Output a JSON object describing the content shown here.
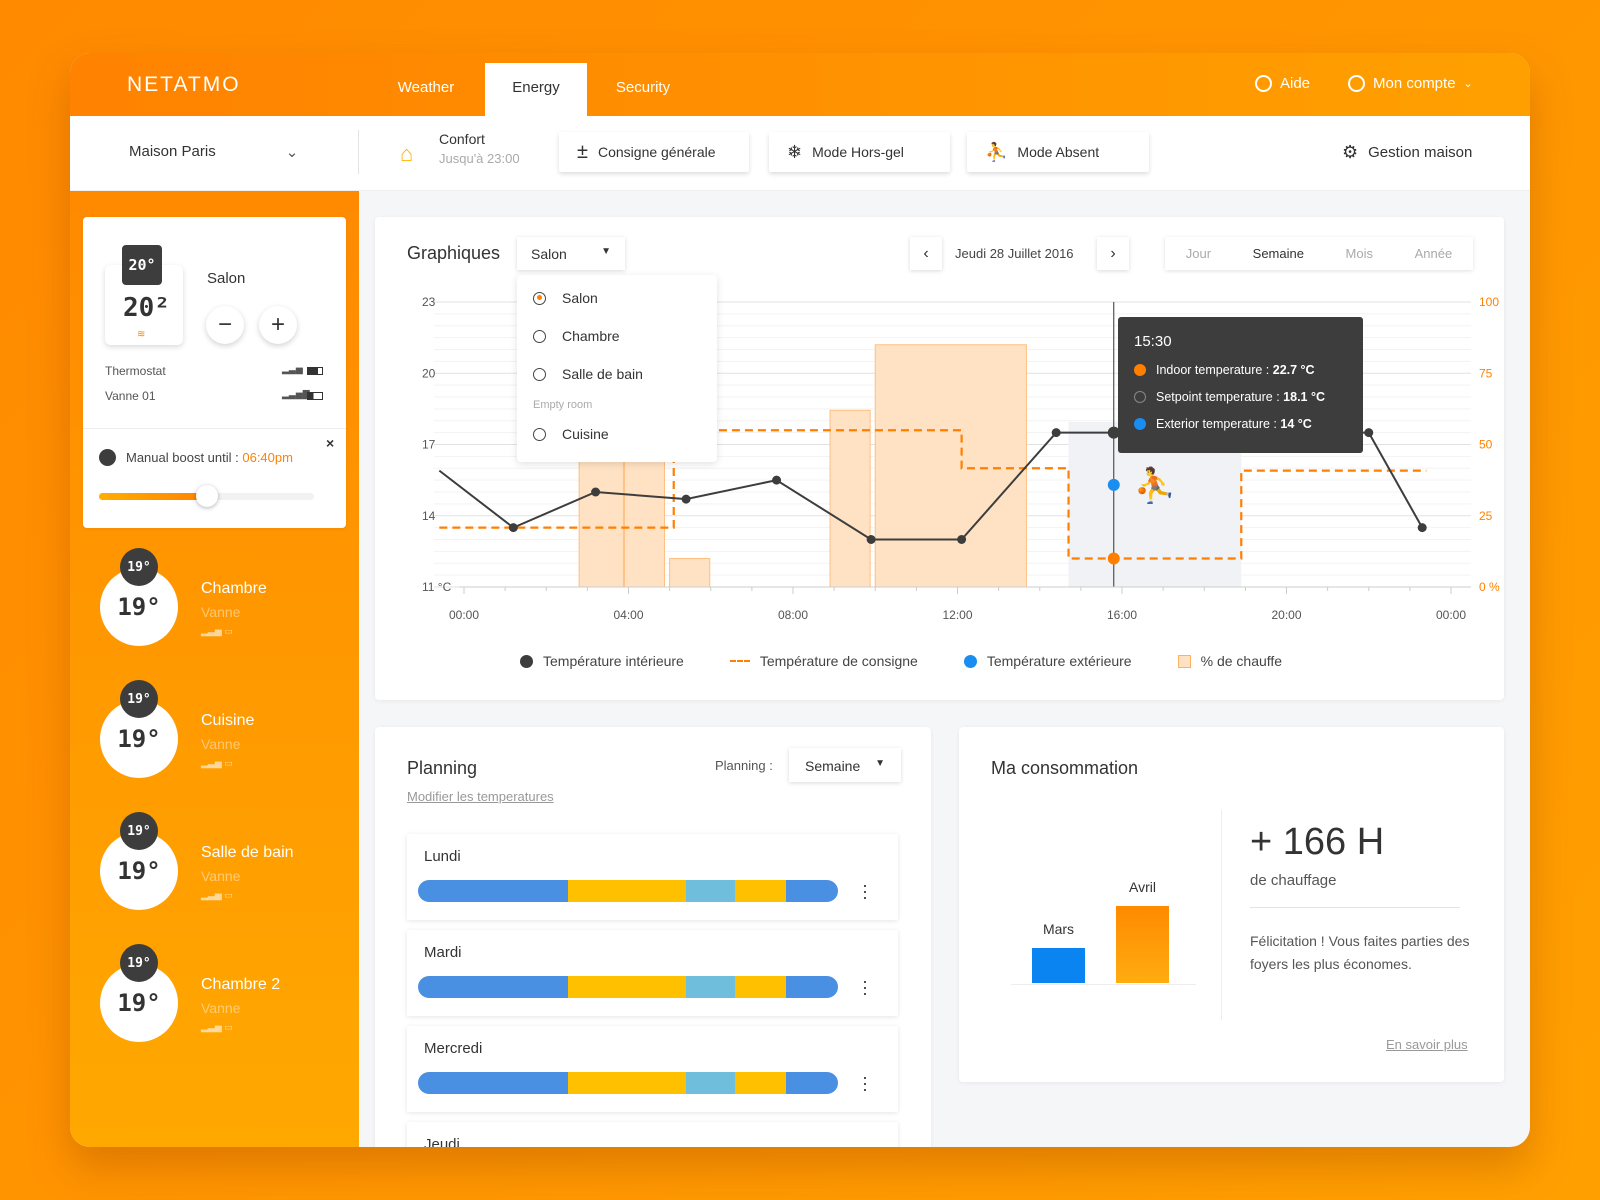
{
  "app": {
    "logo": "NETATMO",
    "tabs": [
      {
        "label": "Weather"
      },
      {
        "label": "Energy",
        "active": true
      },
      {
        "label": "Security"
      }
    ],
    "help": "Aide",
    "account": "Mon compte"
  },
  "toolbar": {
    "home": "Maison Paris",
    "mode_title": "Confort",
    "mode_until": "Jusqu'à 23:00",
    "consigne": "Consigne générale",
    "horsgel": "Mode Hors-gel",
    "absent": "Mode Absent",
    "gestion": "Gestion maison"
  },
  "current_room": {
    "name": "Salon",
    "setpoint": "20°",
    "temperature": "20²",
    "devices": [
      {
        "name": "Thermostat"
      },
      {
        "name": "Vanne 01"
      }
    ],
    "boost_label": "Manual boost until :",
    "boost_time": "06:40pm",
    "boost_progress": 0.5
  },
  "rooms": [
    {
      "name": "Chambre",
      "device": "Vanne",
      "setpoint": "19°",
      "temperature": "19°"
    },
    {
      "name": "Cuisine",
      "device": "Vanne",
      "setpoint": "19°",
      "temperature": "19°"
    },
    {
      "name": "Salle de bain",
      "device": "Vanne",
      "setpoint": "19°",
      "temperature": "19°"
    },
    {
      "name": "Chambre 2",
      "device": "Vanne",
      "setpoint": "19°",
      "temperature": "19°"
    }
  ],
  "graph": {
    "title": "Graphiques",
    "room_select": "Salon",
    "date": "Jeudi 28 Juillet 2016",
    "periods": [
      "Jour",
      "Semaine",
      "Mois",
      "Année"
    ],
    "active_period": "Semaine",
    "dropdown": {
      "items": [
        "Salon",
        "Chambre",
        "Salle de bain"
      ],
      "selected": "Salon",
      "empty_label": "Empty room",
      "empty_items": [
        "Cuisine"
      ]
    },
    "tooltip": {
      "time": "15:30",
      "rows": [
        {
          "label": "Indoor temperature :",
          "value": "22.7 °C",
          "color": "#ff7f00"
        },
        {
          "label": "Setpoint temperature :",
          "value": "18.1 °C",
          "color": "none"
        },
        {
          "label": "Exterior temperature :",
          "value": "14 °C",
          "color": "#1a8ef0"
        }
      ]
    }
  },
  "chart_data": {
    "type": "line",
    "xlabel": "",
    "ylabel": "°C",
    "ylim": [
      11,
      23
    ],
    "y2lim": [
      0,
      100
    ],
    "y_ticks": [
      "23",
      "20",
      "17",
      "14",
      "11 °C"
    ],
    "y_tick_values": [
      23,
      20,
      17,
      14,
      11
    ],
    "y2_ticks": [
      "100",
      "75",
      "50",
      "25",
      "0 %"
    ],
    "y2_tick_values": [
      100,
      75,
      50,
      25,
      0
    ],
    "x_ticks": [
      "00:00",
      "04:00",
      "08:00",
      "12:00",
      "16:00",
      "20:00",
      "00:00"
    ],
    "x_tick_hours": [
      0,
      4,
      8,
      12,
      16,
      20,
      24
    ],
    "series": [
      {
        "name": "Température intérieure",
        "color": "#3d3d3d",
        "points": [
          [
            -0.6,
            15.9
          ],
          [
            1.2,
            13.5
          ],
          [
            3.2,
            15.0
          ],
          [
            5.4,
            14.7
          ],
          [
            7.6,
            15.5
          ],
          [
            9.9,
            13.0
          ],
          [
            12.1,
            13.0
          ],
          [
            14.4,
            17.5
          ],
          [
            15.8,
            17.5
          ],
          [
            22.0,
            17.5
          ],
          [
            23.3,
            13.5
          ]
        ]
      },
      {
        "name": "Température de consigne",
        "color": "#ff7f00",
        "steps": [
          [
            -0.6,
            5.1,
            13.5
          ],
          [
            5.1,
            12.1,
            17.6
          ],
          [
            12.1,
            14.7,
            16.0
          ],
          [
            14.7,
            18.9,
            12.2
          ],
          [
            18.9,
            23.4,
            15.9
          ]
        ]
      },
      {
        "name": "Température extérieure",
        "color": "#1a8ef0",
        "points": [
          [
            15.8,
            15.3
          ]
        ]
      },
      {
        "name": "% de chauffe",
        "color": "#ffe2c4",
        "bars": [
          [
            2.8,
            3.9,
            60
          ],
          [
            3.9,
            4.9,
            60
          ],
          [
            5.0,
            6.0,
            10
          ],
          [
            8.9,
            9.9,
            62
          ],
          [
            10.0,
            13.7,
            85
          ]
        ]
      }
    ],
    "absent_period": [
      14.7,
      18.9
    ],
    "cursor_hour": 15.8,
    "legend": [
      "Température intérieure",
      "Température de consigne",
      "Température extérieure",
      "% de chauffe"
    ]
  },
  "planning": {
    "title": "Planning",
    "link": "Modifier les temperatures",
    "select_label": "Planning :",
    "select_value": "Semaine",
    "segment_colors": {
      "comfort": "#ffc000",
      "night": "#4a90e2",
      "eco": "#6fbfdc"
    },
    "days": [
      {
        "label": "Lundi",
        "segments": [
          [
            "night",
            0.356
          ],
          [
            "comfort",
            0.283
          ],
          [
            "eco",
            0.115
          ],
          [
            "comfort",
            0.122
          ],
          [
            "night",
            0.124
          ]
        ]
      },
      {
        "label": "Mardi",
        "segments": [
          [
            "night",
            0.356
          ],
          [
            "comfort",
            0.283
          ],
          [
            "eco",
            0.115
          ],
          [
            "comfort",
            0.122
          ],
          [
            "night",
            0.124
          ]
        ]
      },
      {
        "label": "Mercredi",
        "segments": [
          [
            "night",
            0.356
          ],
          [
            "comfort",
            0.283
          ],
          [
            "eco",
            0.115
          ],
          [
            "comfort",
            0.122
          ],
          [
            "night",
            0.124
          ]
        ]
      },
      {
        "label": "Jeudi",
        "segments": []
      }
    ]
  },
  "consumption": {
    "title": "Ma consommation",
    "bars": [
      {
        "label": "Mars",
        "value": 35,
        "color": "#0a84f0"
      },
      {
        "label": "Avril",
        "value": 77,
        "color": "#ff8a00"
      }
    ],
    "headline": "+ 166 H",
    "headline_sub": "de chauffage",
    "message": "Félicitation ! Vous faites parties des foyers les plus économes.",
    "link": "En savoir plus"
  }
}
